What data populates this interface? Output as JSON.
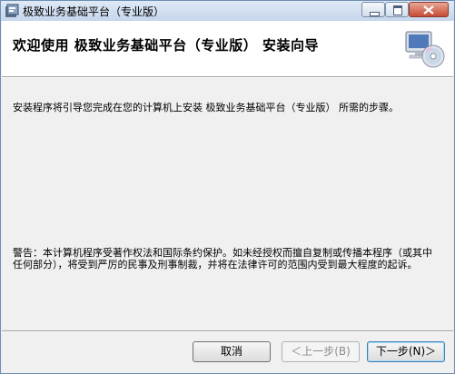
{
  "window": {
    "title": "极致业务基础平台（专业版）"
  },
  "header": {
    "title": "欢迎使用 极致业务基础平台（专业版） 安装向导"
  },
  "content": {
    "intro": "安装程序将引导您完成在您的计算机上安装 极致业务基础平台（专业版） 所需的步骤。",
    "warning": "警告：本计算机程序受著作权法和国际条约保护。如未经授权而擅自复制或传播本程序（或其中任何部分），将受到严厉的民事及刑事制裁，并将在法律许可的范围内受到最大程度的起诉。"
  },
  "buttons": {
    "cancel": "取消",
    "back": "＜上一步(B)",
    "next": "下一步(N)＞"
  }
}
